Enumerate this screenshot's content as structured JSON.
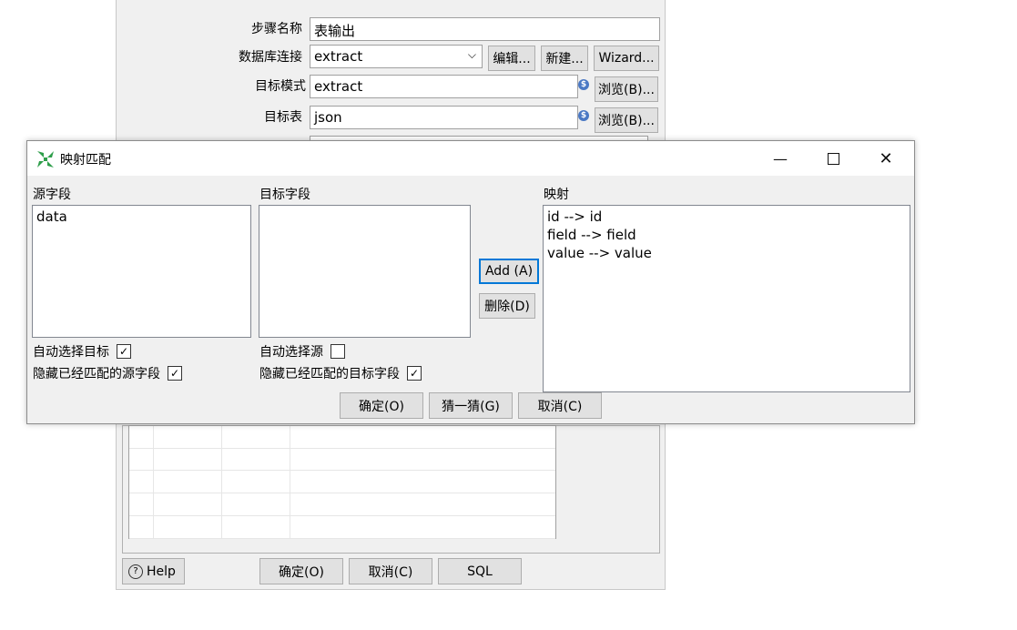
{
  "bg": {
    "step_label": "步骤名称",
    "step_value": "表输出",
    "db_label": "数据库连接",
    "db_value": "extract",
    "edit_btn": "编辑...",
    "new_btn": "新建...",
    "wizard_btn": "Wizard...",
    "schema_label": "目标模式",
    "schema_value": "extract",
    "browse1_btn": "浏览(B)...",
    "table_label": "目标表",
    "table_value": "json",
    "browse2_btn": "浏览(B)...",
    "help_btn": "Help",
    "ok_btn": "确定(O)",
    "cancel_btn": "取消(C)",
    "sql_btn": "SQL"
  },
  "modal": {
    "title": "映射匹配",
    "source_label": "源字段",
    "source_items": [
      "data"
    ],
    "target_label": "目标字段",
    "target_items": [],
    "mapping_label": "映射",
    "mapping_items": [
      "id --> id",
      "field --> field",
      "value --> value"
    ],
    "add_btn": "Add (A)",
    "delete_btn": "删除(D)",
    "auto_target_label": "自动选择目标",
    "auto_target_checked": true,
    "hide_source_label": "隐藏已经匹配的源字段",
    "hide_source_checked": true,
    "auto_source_label": "自动选择源",
    "auto_source_checked": false,
    "hide_target_label": "隐藏已经匹配的目标字段",
    "hide_target_checked": true,
    "ok_btn": "确定(O)",
    "guess_btn": "猜一猜(G)",
    "cancel_btn": "取消(C)"
  }
}
